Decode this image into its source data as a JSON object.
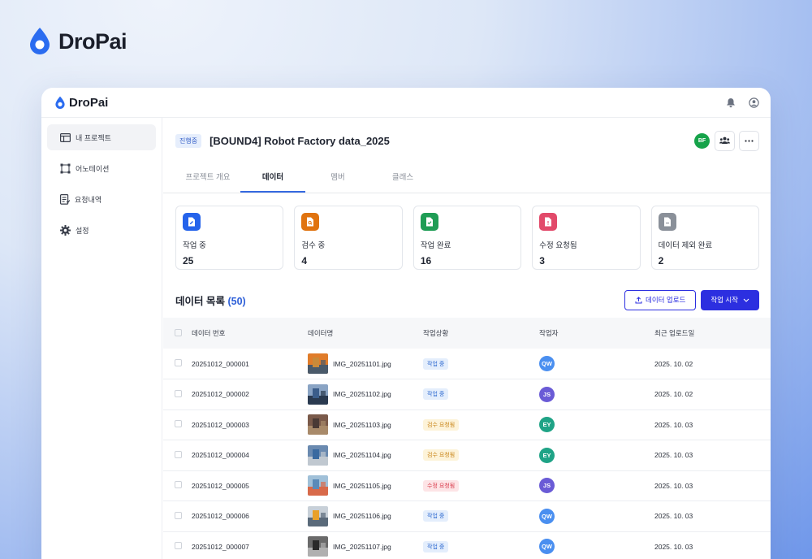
{
  "brand": {
    "name": "DroPai",
    "accent": "#2b6cf0"
  },
  "topbar": {
    "logo": "DroPai",
    "icons": [
      "bell-icon",
      "user-circle-icon"
    ]
  },
  "sidebar": {
    "items": [
      {
        "label": "내 프로젝트",
        "icon": "layout-icon",
        "active": true
      },
      {
        "label": "어노테이션",
        "icon": "bounding-box-icon",
        "active": false
      },
      {
        "label": "요청내역",
        "icon": "document-list-icon",
        "active": false
      },
      {
        "label": "설정",
        "icon": "gear-icon",
        "active": false
      }
    ]
  },
  "project": {
    "status": "진행중",
    "title": "[BOUND4] Robot Factory data_2025",
    "owner_initials": "BF",
    "owner_color": "#16a34a"
  },
  "tabs": [
    {
      "label": "프로젝트 개요",
      "active": false
    },
    {
      "label": "데이터",
      "active": true
    },
    {
      "label": "멤버",
      "active": false
    },
    {
      "label": "클래스",
      "active": false
    }
  ],
  "stats": [
    {
      "label": "작업 중",
      "value": "25",
      "color": "#2563eb"
    },
    {
      "label": "검수 중",
      "value": "4",
      "color": "#e0730f"
    },
    {
      "label": "작업 완료",
      "value": "16",
      "color": "#1f9d55"
    },
    {
      "label": "수정 요청됨",
      "value": "3",
      "color": "#e24a6a"
    },
    {
      "label": "데이터 제외 완료",
      "value": "2",
      "color": "#8a9099"
    }
  ],
  "list": {
    "title": "데이터 목록",
    "count": "(50)",
    "upload_label": "데이터 업로드",
    "start_label": "작업 시작",
    "columns": [
      "데이터 번호",
      "데이터명",
      "작업상황",
      "작업자",
      "최근 업로드일"
    ],
    "rows": [
      {
        "id": "20251012_000001",
        "name": "IMG_20251101.jpg",
        "status": "작업 중",
        "status_type": "working",
        "worker": "QW",
        "worker_color": "#4a8ff0",
        "date": "2025. 10. 02"
      },
      {
        "id": "20251012_000002",
        "name": "IMG_20251102.jpg",
        "status": "작업 중",
        "status_type": "working",
        "worker": "JS",
        "worker_color": "#6a5bd6",
        "date": "2025. 10. 02"
      },
      {
        "id": "20251012_000003",
        "name": "IMG_20251103.jpg",
        "status": "검수 요청됨",
        "status_type": "review",
        "worker": "EY",
        "worker_color": "#1fa386",
        "date": "2025. 10. 03"
      },
      {
        "id": "20251012_000004",
        "name": "IMG_20251104.jpg",
        "status": "검수 요청됨",
        "status_type": "review",
        "worker": "EY",
        "worker_color": "#1fa386",
        "date": "2025. 10. 03"
      },
      {
        "id": "20251012_000005",
        "name": "IMG_20251105.jpg",
        "status": "수정 요청됨",
        "status_type": "revision",
        "worker": "JS",
        "worker_color": "#6a5bd6",
        "date": "2025. 10. 03"
      },
      {
        "id": "20251012_000006",
        "name": "IMG_20251106.jpg",
        "status": "작업 중",
        "status_type": "working",
        "worker": "QW",
        "worker_color": "#4a8ff0",
        "date": "2025. 10. 03"
      },
      {
        "id": "20251012_000007",
        "name": "IMG_20251107.jpg",
        "status": "작업 중",
        "status_type": "working",
        "worker": "QW",
        "worker_color": "#4a8ff0",
        "date": "2025. 10. 03"
      }
    ]
  }
}
